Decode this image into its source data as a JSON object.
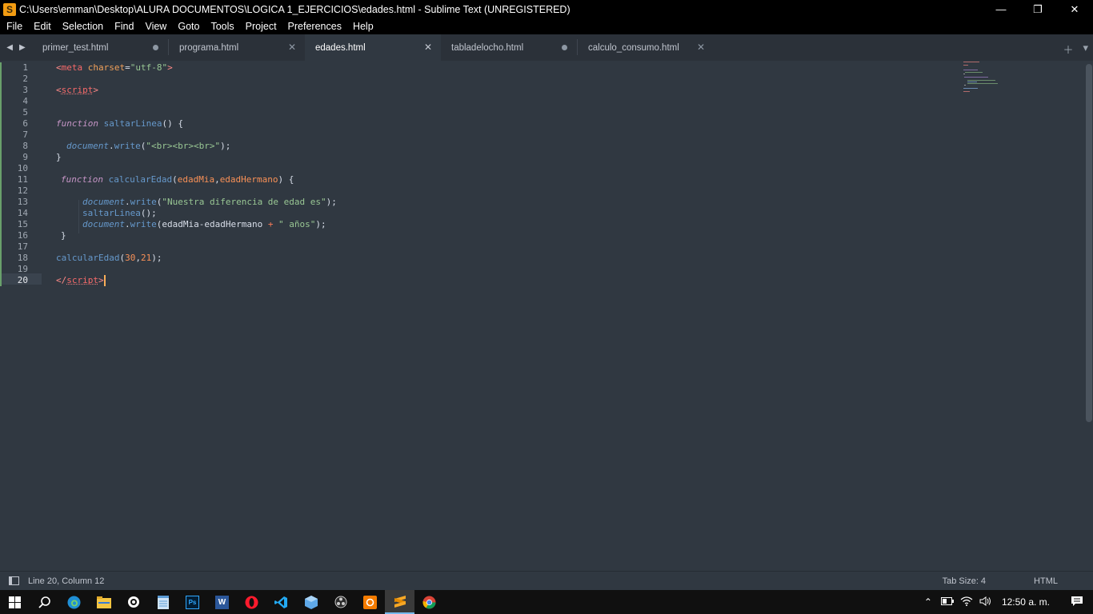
{
  "window": {
    "title": "C:\\Users\\emman\\Desktop\\ALURA DOCUMENTOS\\LOGICA 1_EJERCICIOS\\edades.html - Sublime Text (UNREGISTERED)",
    "app_icon": "S"
  },
  "menu": {
    "items": [
      "File",
      "Edit",
      "Selection",
      "Find",
      "View",
      "Goto",
      "Tools",
      "Project",
      "Preferences",
      "Help"
    ]
  },
  "tabs": [
    {
      "label": "primer_test.html",
      "modified": true
    },
    {
      "label": "programa.html",
      "modified": false
    },
    {
      "label": "edades.html",
      "modified": false,
      "active": true
    },
    {
      "label": "tabladelocho.html",
      "modified": true
    },
    {
      "label": "calculo_consumo.html",
      "modified": false
    }
  ],
  "editor": {
    "line_numbers": [
      "1",
      "2",
      "3",
      "4",
      "5",
      "6",
      "7",
      "8",
      "9",
      "10",
      "11",
      "12",
      "13",
      "14",
      "15",
      "16",
      "17",
      "18",
      "19",
      "20"
    ],
    "current_line": 20,
    "code": {
      "l1_open": "<",
      "l1_tag": "meta",
      "l1_attr": " charset",
      "l1_eq": "=",
      "l1_val": "\"utf-8\"",
      "l1_close": ">",
      "l3_open": "<",
      "l3_tag": "script",
      "l3_close": ">",
      "l6_kw": "function",
      "l6_name": " saltarLinea",
      "l6_rest": "() {",
      "l8_obj": "document",
      "l8_dot": ".",
      "l8_meth": "write",
      "l8_paren": "(",
      "l8_str": "\"<br><br><br>\"",
      "l8_end": ");",
      "l9": "}",
      "l11_kw": "function",
      "l11_name": " calcularEdad",
      "l11_p1": "(",
      "l11_a1": "edadMia",
      "l11_comma": ",",
      "l11_a2": "edadHermano",
      "l11_end": ") {",
      "l13_obj": "document",
      "l13_dot": ".",
      "l13_meth": "write",
      "l13_paren": "(",
      "l13_str": "\"Nuestra diferencia de edad es\"",
      "l13_end": ");",
      "l14_call": "saltarLinea",
      "l14_end": "();",
      "l15_obj": "document",
      "l15_dot": ".",
      "l15_meth": "write",
      "l15_args": "(edadMia-edadHermano ",
      "l15_op": "+",
      "l15_str": " \" años\"",
      "l15_end": ");",
      "l16": "}",
      "l18_call": "calcularEdad",
      "l18_p": "(",
      "l18_n1": "30",
      "l18_comma": ",",
      "l18_n2": "21",
      "l18_end": ");",
      "l20_open": "</",
      "l20_tag": "script",
      "l20_close": ">"
    }
  },
  "status": {
    "position": "Line 20, Column 12",
    "tab_size": "Tab Size: 4",
    "syntax": "HTML"
  },
  "taskbar": {
    "clock": "12:50 a. m.",
    "apps": [
      "windows-start-icon",
      "search-icon",
      "edge-icon",
      "file-explorer-icon",
      "xbox-icon",
      "notepad-icon",
      "photoshop-icon",
      "word-icon",
      "opera-icon",
      "vscode-icon",
      "3d-viewer-icon",
      "obs-icon",
      "git-icon",
      "sublime-text-icon",
      "chrome-icon"
    ],
    "ps_label": "Ps",
    "word_label": "W"
  }
}
